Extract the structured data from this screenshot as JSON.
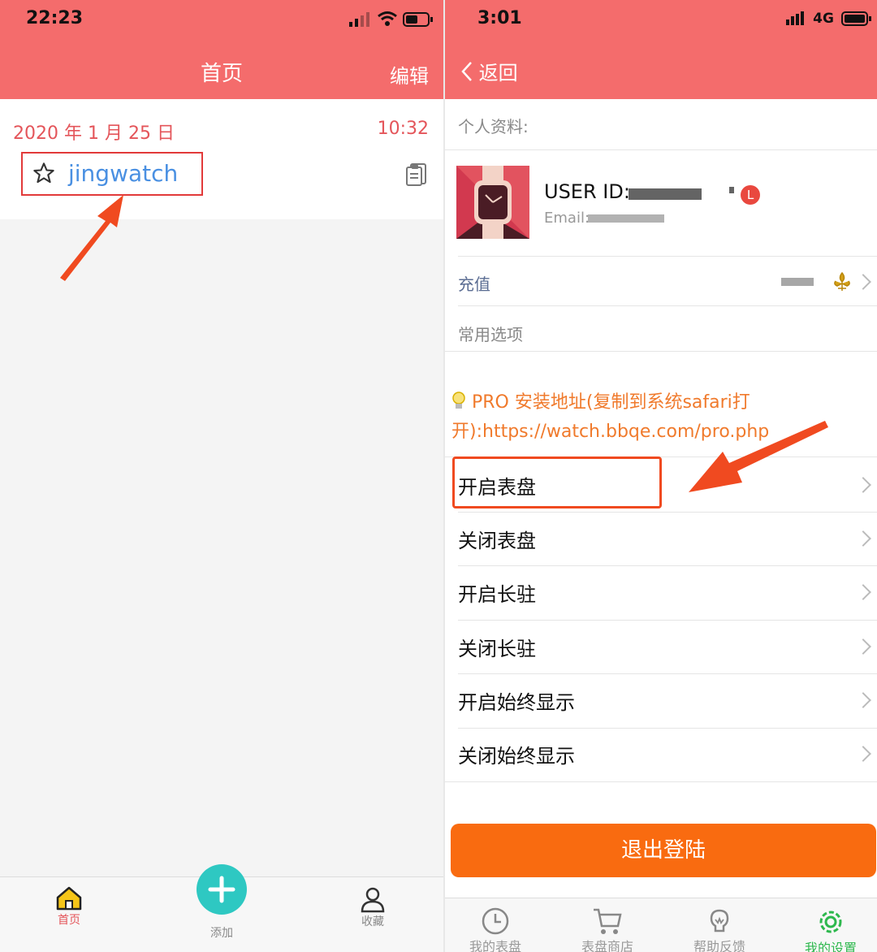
{
  "left": {
    "status": {
      "time": "22:23"
    },
    "nav": {
      "title": "首页",
      "edit": "编辑"
    },
    "entry": {
      "date": "2020 年 1 月 25 日",
      "time": "10:32",
      "name": "jingwatch"
    },
    "tabs": [
      {
        "label": "首页",
        "icon": "home-icon",
        "active": true
      },
      {
        "label": "添加",
        "icon": "plus-icon",
        "active": false
      },
      {
        "label": "收藏",
        "icon": "person-icon",
        "active": false
      }
    ],
    "colors": {
      "nav": "#f46c6c",
      "accent": "#e4555a",
      "link": "#4a90e2",
      "add": "#2ec8c2",
      "arrow": "#f04a20"
    }
  },
  "right": {
    "status": {
      "time": "3:01",
      "network": "4G"
    },
    "nav": {
      "back": "返回"
    },
    "profile": {
      "section_label": "个人资料:",
      "user_id": "USER ID:",
      "email": "Email:",
      "badge": "L"
    },
    "recharge": {
      "label": "充值"
    },
    "common": {
      "label": "常用选项"
    },
    "pro_text": "PRO 安装地址(复制到系统safari打开):https://watch.bbqe.com/pro.php",
    "menu": [
      {
        "label": "开启表盘"
      },
      {
        "label": "关闭表盘"
      },
      {
        "label": "开启长驻"
      },
      {
        "label": "关闭长驻"
      },
      {
        "label": "开启始终显示"
      },
      {
        "label": "关闭始终显示"
      }
    ],
    "logout": "退出登陆",
    "tabs": [
      {
        "label": "我的表盘",
        "icon": "clock-icon"
      },
      {
        "label": "表盘商店",
        "icon": "cart-icon"
      },
      {
        "label": "帮助反馈",
        "icon": "bulb-icon"
      },
      {
        "label": "我的设置",
        "icon": "settings-icon"
      }
    ],
    "colors": {
      "logout": "#f96b10",
      "pro": "#f07a2c",
      "active_tab": "#2db84d"
    }
  }
}
